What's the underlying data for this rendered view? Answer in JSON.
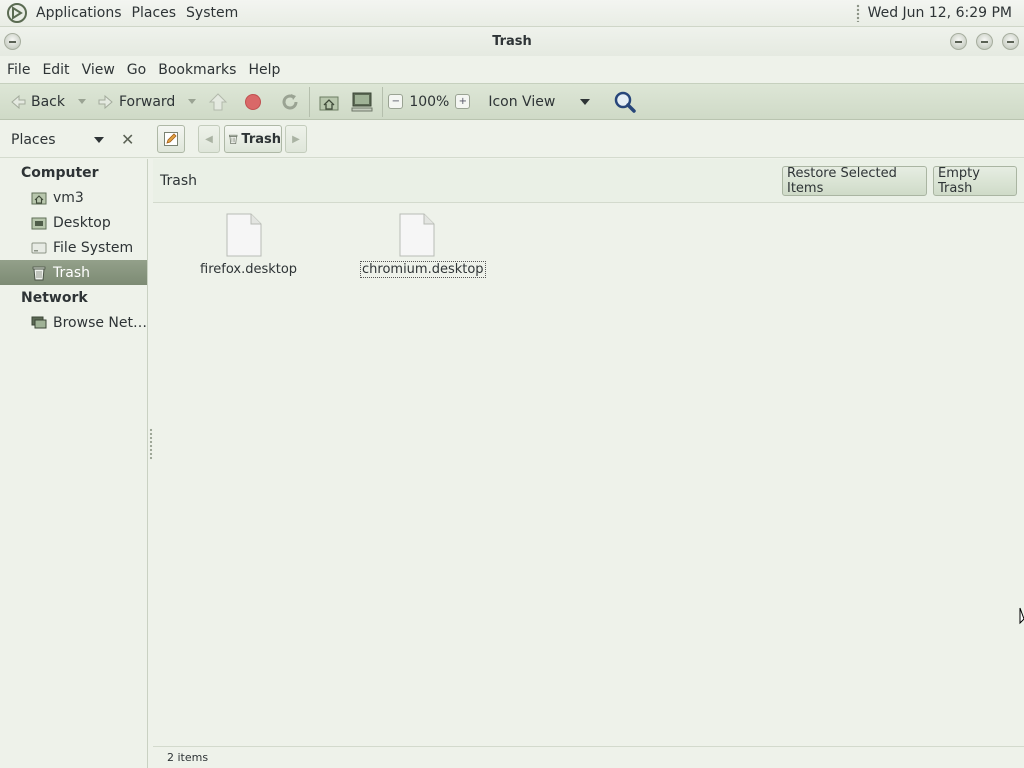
{
  "top_panel": {
    "menus": [
      "Applications",
      "Places",
      "System"
    ],
    "clock": "Wed Jun 12,  6:29 PM"
  },
  "window": {
    "title": "Trash"
  },
  "menubar": [
    "File",
    "Edit",
    "View",
    "Go",
    "Bookmarks",
    "Help"
  ],
  "toolbar": {
    "back_label": "Back",
    "forward_label": "Forward",
    "zoom_level": "100%",
    "view_mode": "Icon View"
  },
  "location": {
    "places_label": "Places",
    "breadcrumb": "Trash"
  },
  "sidebar": {
    "sections": [
      {
        "title": "Computer",
        "items": [
          {
            "label": "vm3",
            "icon": "home-folder-icon"
          },
          {
            "label": "Desktop",
            "icon": "desktop-folder-icon"
          },
          {
            "label": "File System",
            "icon": "harddisk-icon"
          },
          {
            "label": "Trash",
            "icon": "trash-icon",
            "selected": true
          }
        ]
      },
      {
        "title": "Network",
        "items": [
          {
            "label": "Browse Net…",
            "icon": "network-icon"
          }
        ]
      }
    ]
  },
  "main": {
    "location_title": "Trash",
    "restore_label": "Restore Selected Items",
    "empty_label": "Empty Trash",
    "files": [
      {
        "name": "firefox.desktop",
        "selected": false
      },
      {
        "name": "chromium.desktop",
        "selected": true
      }
    ]
  },
  "status": {
    "text": "2 items"
  },
  "colors": {
    "selection": "#7f8c76",
    "background": "#eef2ea"
  }
}
